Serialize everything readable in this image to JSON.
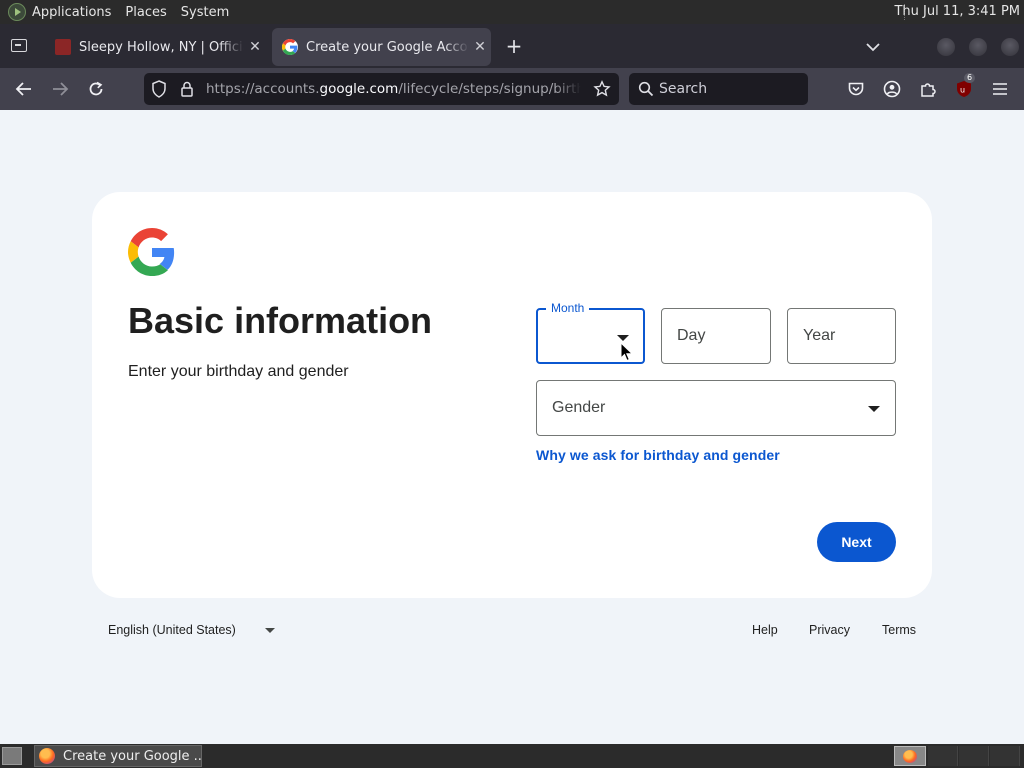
{
  "top_panel": {
    "menus": [
      "Applications",
      "Places",
      "System"
    ],
    "clock": "Thu Jul 11,  3:41 PM"
  },
  "browser": {
    "tabs": [
      {
        "title": "Sleepy Hollow, NY | Official",
        "active": false
      },
      {
        "title": "Create your Google Account",
        "active": true
      }
    ],
    "url_prefix": "https://accounts.",
    "url_host": "google.com",
    "url_path": "/lifecycle/steps/signup/birthdaygender",
    "search_placeholder": "Search",
    "extension_badge": "6"
  },
  "signup": {
    "headline": "Basic information",
    "subheadline": "Enter your birthday and gender",
    "month_label": "Month",
    "month_value": "",
    "day_placeholder": "Day",
    "year_placeholder": "Year",
    "gender_placeholder": "Gender",
    "why_link": "Why we ask for birthday and gender",
    "next_label": "Next"
  },
  "footer": {
    "language": "English (United States)",
    "links": [
      "Help",
      "Privacy",
      "Terms"
    ]
  },
  "taskbar": {
    "window_title": "Create your Google ..."
  },
  "colors": {
    "accent": "#0b57d0",
    "page_bg": "#f0f4f9",
    "card_bg": "#ffffff",
    "chrome_dark": "#2b2a33",
    "toolbar": "#42414d"
  }
}
